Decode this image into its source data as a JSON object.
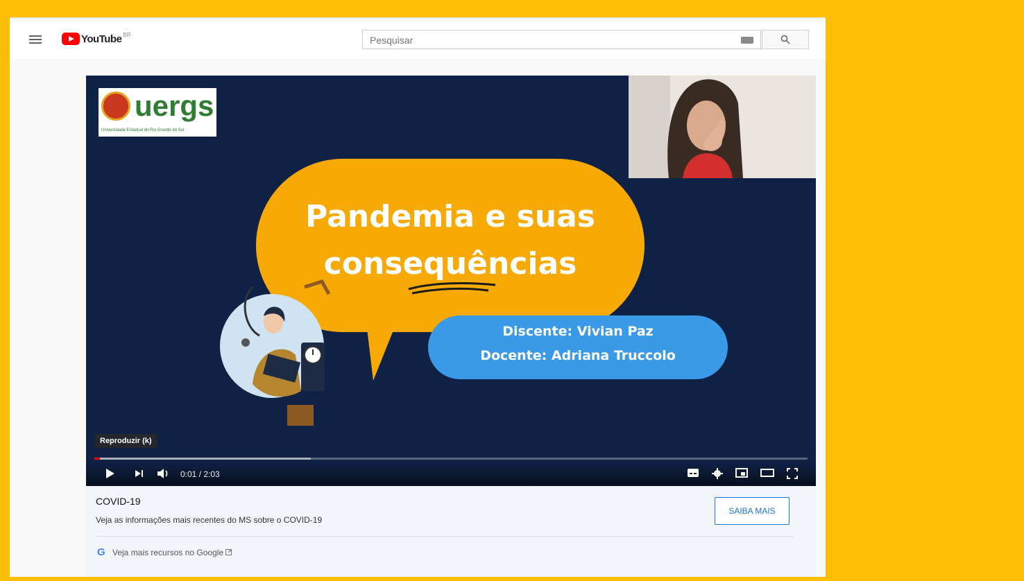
{
  "app": {
    "logo_text": "YouTube",
    "region": "BR"
  },
  "search": {
    "placeholder": "Pesquisar"
  },
  "video": {
    "channel_logo_text": "uergs",
    "channel_logo_subtext": "Universidade Estadual do Rio Grande do Sul",
    "title_line1": "Pandemia e suas",
    "title_line2": "consequências",
    "credit_line1": "Discente: Vivian Paz",
    "credit_line2": "Docente: Adriana Truccolo",
    "tooltip": "Reproduzir (k)",
    "time": "0:01 / 2:03",
    "progress_fraction": 0.008
  },
  "info_panel": {
    "title": "COVID-19",
    "description": "Veja as informações mais recentes do MS sobre o COVID-19",
    "button_label": "SAIBA MAIS",
    "google_letter": "G",
    "google_link": "Veja mais recursos no Google"
  },
  "colors": {
    "brand_red": "#ff0000",
    "bubble_orange": "#f7a905",
    "pill_blue": "#3b9ae8",
    "video_bg": "#0f2246",
    "accent_blue": "#1a73e8"
  }
}
